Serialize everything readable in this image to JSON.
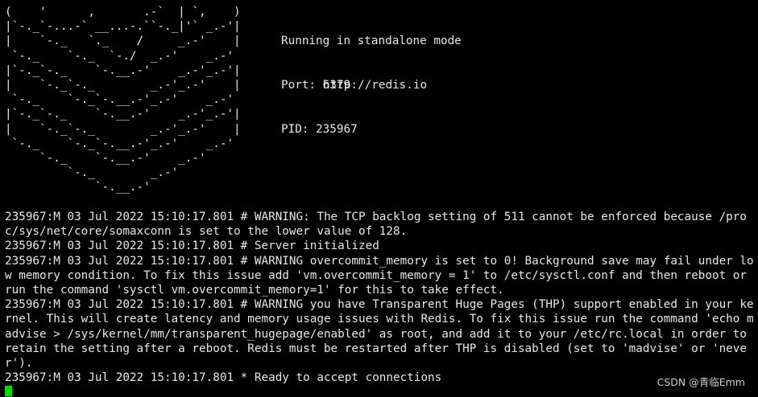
{
  "logo": {
    "art": "(    '      ,       .-`  | `,    )\n|`-._`-...-` __...-.``-._|'` _.-'|\n|    `-._   `._    /     _.-'    |\n `-._    `-._  `-./  _.-'    _.-'\n|`-._`-._    `-.__.-'    _.-'_.-'|\n|    `-._`-._        _.-'_.-'    |\n `-._    `-._`-.__.-'_.-'    _.-'\n|`-._`-._    `-.__.-'    _.-'_.-'|\n|    `-._`-._        _.-'_.-'    |\n `-._    `-._`-.__.-'_.-'    _.-'\n     `-._    `-.__.-'    _.-'\n         `-._        _.-'\n             `-.__.-'"
  },
  "server_info": {
    "mode": "Running in standalone mode",
    "port": "Port: 6379",
    "pid": "PID: 235967",
    "url": "http://redis.io"
  },
  "log_lines": [
    "235967:M 03 Jul 2022 15:10:17.801 # WARNING: The TCP backlog setting of 511 cannot be enforced because /proc/sys/net/core/somaxconn is set to the lower value of 128.",
    "235967:M 03 Jul 2022 15:10:17.801 # Server initialized",
    "235967:M 03 Jul 2022 15:10:17.801 # WARNING overcommit_memory is set to 0! Background save may fail under low memory condition. To fix this issue add 'vm.overcommit_memory = 1' to /etc/sysctl.conf and then reboot or run the command 'sysctl vm.overcommit_memory=1' for this to take effect.",
    "235967:M 03 Jul 2022 15:10:17.801 # WARNING you have Transparent Huge Pages (THP) support enabled in your kernel. This will create latency and memory usage issues with Redis. To fix this issue run the command 'echo madvise > /sys/kernel/mm/transparent_hugepage/enabled' as root, and add it to your /etc/rc.local in order to retain the setting after a reboot. Redis must be restarted after THP is disabled (set to 'madvise' or 'never').",
    "235967:M 03 Jul 2022 15:10:17.801 * Ready to accept connections"
  ],
  "watermark": "CSDN @青临Emm",
  "colors": {
    "background": "#000000",
    "text": "#e8e8e8",
    "cursor": "#00e000"
  }
}
